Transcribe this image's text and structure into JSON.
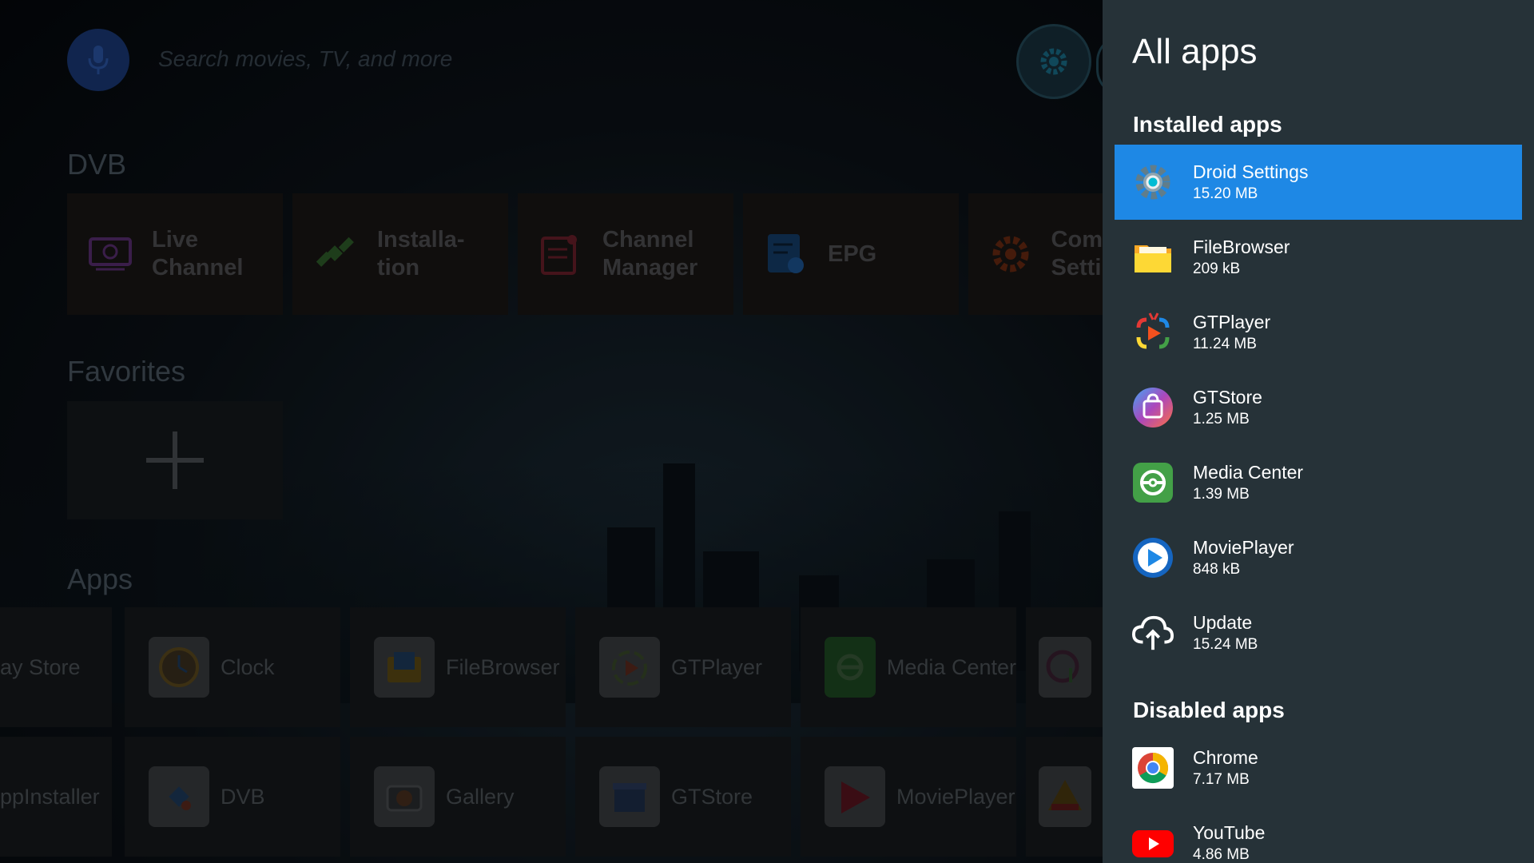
{
  "search": {
    "placeholder": "Search movies, TV, and more"
  },
  "sections": {
    "dvb": "DVB",
    "favorites": "Favorites",
    "apps": "Apps"
  },
  "dvb_tiles": [
    {
      "label_line1": "Live",
      "label_line2": "Channel",
      "icon": "live-channel-icon"
    },
    {
      "label_line1": "Installa-",
      "label_line2": "tion",
      "icon": "satellite-icon"
    },
    {
      "label_line1": "Channel",
      "label_line2": "Manager",
      "icon": "channel-manager-icon"
    },
    {
      "label_line1": "EPG",
      "label_line2": "",
      "icon": "epg-icon"
    },
    {
      "label_line1": "Com",
      "label_line2": "Setti",
      "icon": "gear-icon"
    }
  ],
  "apps_row1": [
    "ay Store",
    "Clock",
    "FileBrowser",
    "GTPlayer",
    "Media Center"
  ],
  "apps_row2": [
    "ppInstaller",
    "DVB",
    "Gallery",
    "GTStore",
    "MoviePlayer"
  ],
  "panel": {
    "title": "All apps",
    "installed_title": "Installed apps",
    "disabled_title": "Disabled apps",
    "installed": [
      {
        "name": "Droid Settings",
        "size": "15.20 MB",
        "icon": "settings-gear-icon",
        "selected": true
      },
      {
        "name": "FileBrowser",
        "size": "209 kB",
        "icon": "folder-icon"
      },
      {
        "name": "GTPlayer",
        "size": "11.24 MB",
        "icon": "gtplayer-icon"
      },
      {
        "name": "GTStore",
        "size": "1.25 MB",
        "icon": "shopping-bag-icon"
      },
      {
        "name": "Media Center",
        "size": "1.39 MB",
        "icon": "media-center-icon"
      },
      {
        "name": "MoviePlayer",
        "size": "848 kB",
        "icon": "play-circle-icon"
      },
      {
        "name": "Update",
        "size": "15.24 MB",
        "icon": "cloud-upload-icon"
      }
    ],
    "disabled": [
      {
        "name": "Chrome",
        "size": "7.17 MB",
        "icon": "chrome-icon"
      },
      {
        "name": "YouTube",
        "size": "4.86 MB",
        "icon": "youtube-icon"
      }
    ]
  },
  "colors": {
    "panel_bg": "#263238",
    "selection": "#1e88e5"
  }
}
